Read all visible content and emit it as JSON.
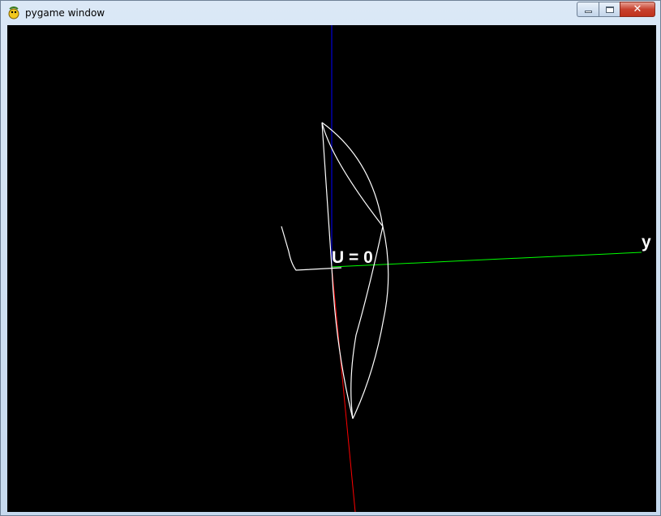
{
  "window": {
    "title": "pygame window",
    "icon": "pygame-snake-icon",
    "controls": {
      "minimize_icon": "minimize-icon",
      "maximize_icon": "maximize-icon",
      "close_label": "✕"
    }
  },
  "scene": {
    "background": "#000000",
    "axis_colors": {
      "x_axis": "#ff0000",
      "y_axis": "#00ff00",
      "z_axis": "#0000ff"
    },
    "curve_color": "#ffffff",
    "label_u": "U = 0",
    "label_y": "y"
  }
}
